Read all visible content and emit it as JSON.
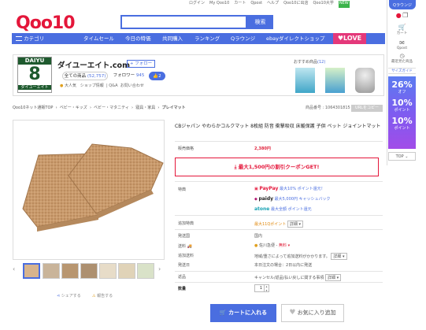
{
  "header": {
    "logo": "Qoo10",
    "search_button": "検索",
    "search_value": "",
    "top_links": [
      "ログイン",
      "My Qoo10",
      "カート",
      "Qpost",
      "ヘルプ",
      "Qoo10に出店",
      "Qoo10大学"
    ],
    "new_badge": "NEW"
  },
  "nav": {
    "category": "カテゴリ",
    "items": [
      "タイムセール",
      "今日の特価",
      "共同購入",
      "ランキング",
      "Qラウンジ",
      "ebayダイレクトショップ"
    ],
    "love": "LOVE"
  },
  "sidebar": {
    "qlounge": "Qラウンジ",
    "items": [
      "カート",
      "Qpost",
      "最近見た商品",
      "サイズガイド"
    ],
    "banner": [
      "26%",
      "オフ",
      "10%",
      "ポイント",
      "10%",
      "ポイント"
    ],
    "top": "TOP"
  },
  "shop": {
    "logo_text": "DAIYU",
    "logo_num": "8",
    "logo_sub": "ダイユーエイト",
    "name": "ダイユーエイト.com",
    "follow": "+ フォロー",
    "all_items_label": "全ての商品",
    "all_items_count": "(52,757)",
    "followers_label": "フォロワー",
    "followers_count": "945",
    "like_count": "2",
    "grade": "大人気",
    "shop_info": "ショップ情報",
    "qa": "Q&A",
    "inquiry": "お問い合わせ",
    "recommended_label": "おすすめ商品",
    "recommended_count": "(12)"
  },
  "breadcrumb": [
    "Qoo10ネット通販TOP",
    "ベビー・キッズ",
    "ベビー・マタニティ",
    "寝具・家具",
    "プレイマット"
  ],
  "product": {
    "number_label": "商品番号 :",
    "number": "1064301815",
    "copy_url": "URLをコピー",
    "title": "CBジャパン やわらかコルクマット 8枚組 防音 衝撃吸収 床暖保護 子供 ペット ジョイントマット",
    "price_label": "販売価格",
    "price": "2,380円",
    "coupon": "最大1,500円の割引クーポンGET!",
    "benefit_label": "特典",
    "payments": [
      {
        "name": "PayPay",
        "note": "最大10% ポイント還元！"
      },
      {
        "name": "paidy",
        "note": "最大5,000円 キャッシュバック"
      },
      {
        "name": "atone",
        "note": "最大全額 ポイント還元"
      }
    ],
    "points_label": "追加特典",
    "points": "最大11Qポイント",
    "detail": "詳細",
    "ship_from_label": "発送国",
    "ship_from": "国内",
    "shipping_label": "送料",
    "shipping_method": "佐川急便 -",
    "shipping_fee": "無料",
    "extra_ship_label": "追加送料",
    "extra_ship": "地域/重さによって追加送料がかかります。",
    "ship_date_label": "発送日",
    "ship_date": "本日注文の場合：2日以内に発送",
    "return_label": "返品",
    "return_text": "キャンセル/返品/払い戻しに関する事項",
    "qty_label": "数量",
    "qty": "1",
    "add_cart": "カートに入れる",
    "wish": "お気に入り追加",
    "share": "シェアする",
    "report": "報告する"
  }
}
